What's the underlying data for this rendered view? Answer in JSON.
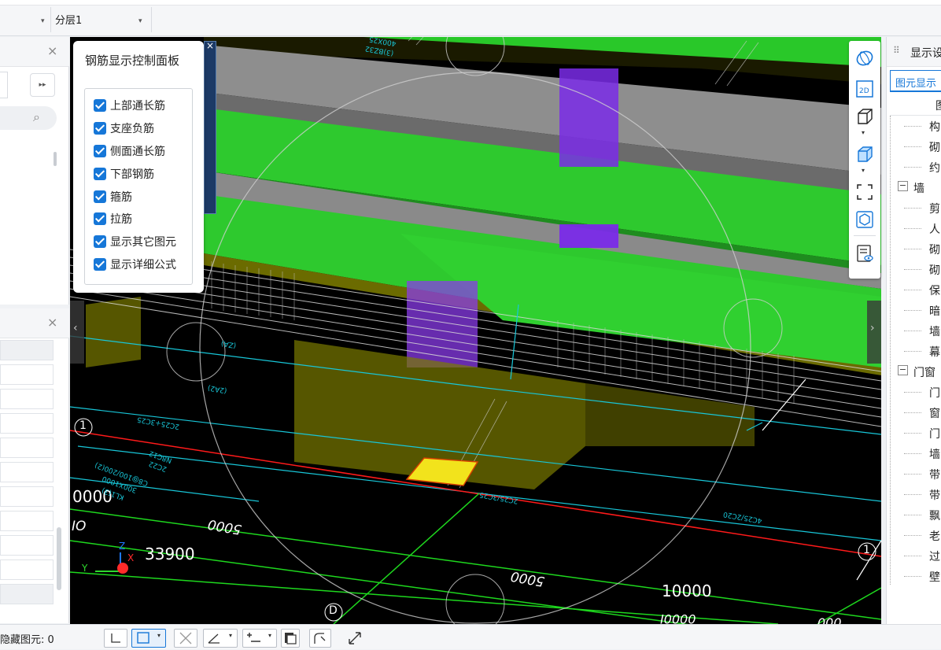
{
  "toolbar": {
    "floor_combo_arrow": "▾",
    "layer_combo_value": "分层1",
    "layer_combo_arrow": "▾"
  },
  "rebar_panel": {
    "title": "钢筋显示控制面板",
    "close": "×",
    "items": [
      {
        "label": "上部通长筋",
        "checked": true
      },
      {
        "label": "支座负筋",
        "checked": true
      },
      {
        "label": "侧面通长筋",
        "checked": true
      },
      {
        "label": "下部钢筋",
        "checked": true
      },
      {
        "label": "箍筋",
        "checked": true
      },
      {
        "label": "拉筋",
        "checked": true
      },
      {
        "label": "显示其它图元",
        "checked": true
      },
      {
        "label": "显示详细公式",
        "checked": true
      }
    ]
  },
  "viewport": {
    "dims": [
      "33900",
      "0000",
      "5000",
      "5000",
      "10000",
      "IO",
      "0000I",
      "000"
    ],
    "axis_labels": [
      "1",
      "1",
      "D"
    ],
    "axis_triad": [
      "Z",
      "X",
      "Y"
    ],
    "annotations": [
      "2C25+3C25",
      "2C25/3C25",
      "4C25/2C20",
      "400X25",
      "(3)BZ32",
      "KL1(3)",
      "300X1000",
      "2C22",
      "C8@100/200(2)",
      "N8C12",
      "(2A2)",
      "(ZA)",
      "4C25/2C20"
    ]
  },
  "right_panel": {
    "title": "显示设",
    "tab": "图元显示",
    "column_header": "图",
    "items": [
      {
        "label": "构",
        "indent": 1
      },
      {
        "label": "砌",
        "indent": 1
      },
      {
        "label": "约",
        "indent": 1
      },
      {
        "label": "墙",
        "indent": 0,
        "toggle": "−"
      },
      {
        "label": "剪",
        "indent": 1
      },
      {
        "label": "人",
        "indent": 1
      },
      {
        "label": "砌",
        "indent": 1
      },
      {
        "label": "砌",
        "indent": 1
      },
      {
        "label": "保",
        "indent": 1
      },
      {
        "label": "暗",
        "indent": 1
      },
      {
        "label": "墙",
        "indent": 1
      },
      {
        "label": "幕",
        "indent": 1
      },
      {
        "label": "门窗",
        "indent": 0,
        "toggle": "−"
      },
      {
        "label": "门",
        "indent": 1
      },
      {
        "label": "窗",
        "indent": 1
      },
      {
        "label": "门",
        "indent": 1
      },
      {
        "label": "墙",
        "indent": 1
      },
      {
        "label": "带",
        "indent": 1
      },
      {
        "label": "带",
        "indent": 1
      },
      {
        "label": "飘",
        "indent": 1
      },
      {
        "label": "老",
        "indent": 1
      },
      {
        "label": "过",
        "indent": 1
      },
      {
        "label": "壁",
        "indent": 1
      }
    ]
  },
  "status_bar": {
    "hidden_label": "隐藏图元: 0",
    "arrow": "▾"
  },
  "icons": {
    "close": "×",
    "search": "⌕",
    "expand": "▸▸",
    "nav_left": "‹",
    "nav_right": "›",
    "drag": "⠿"
  },
  "colors": {
    "accent": "#1677d8",
    "beam_green": "#2ec92e",
    "column_purple": "#8a2be2",
    "axis_red": "#ff1a1a",
    "grid_cyan": "#18c6d8"
  }
}
